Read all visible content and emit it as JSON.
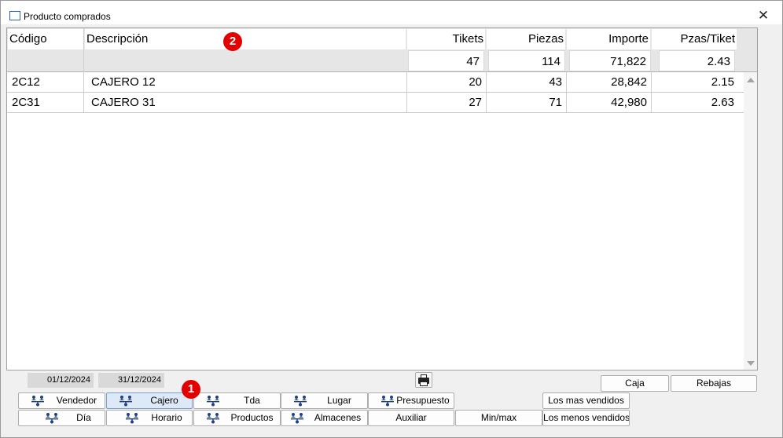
{
  "window": {
    "title": "Producto comprados",
    "close_label": "✕"
  },
  "table": {
    "columns": [
      "Código",
      "Descripción",
      "Tikets",
      "Piezas",
      "Importe",
      "Pzas/Tiket"
    ],
    "totals": {
      "tikets": "47",
      "piezas": "114",
      "importe": "71,822",
      "pzas_tiket": "2.43"
    },
    "rows": [
      {
        "codigo": "2C12",
        "descripcion": "CAJERO 12",
        "tikets": "20",
        "piezas": "43",
        "importe": "28,842",
        "pzas_tiket": "2.15"
      },
      {
        "codigo": "2C31",
        "descripcion": "CAJERO 31",
        "tikets": "27",
        "piezas": "71",
        "importe": "42,980",
        "pzas_tiket": "2.63"
      }
    ]
  },
  "dates": {
    "from": "01/12/2024",
    "to": "31/12/2024"
  },
  "buttons": {
    "vendedor": "Vendedor",
    "cajero": "Cajero",
    "tda": "Tda",
    "lugar": "Lugar",
    "presupuesto": "Presupuesto",
    "dia": "Día",
    "horario": "Horario",
    "productos": "Productos",
    "almacenes": "Almacenes",
    "auxiliar": "Auxiliar",
    "minmax": "Min/max",
    "mas_vendidos": "Los mas vendidos",
    "menos_vendidos": "Los menos vendidos",
    "caja": "Caja",
    "rebajas": "Rebajas"
  },
  "markers": {
    "m1": "1",
    "m2": "2"
  },
  "colors": {
    "selected_button": "#dde9f7",
    "marker": "#e30000",
    "icon": "#1f3f8a"
  },
  "icons": {
    "group_icon": "people-tree-icon",
    "print_icon": "printer-icon",
    "close_icon": "close-icon"
  }
}
